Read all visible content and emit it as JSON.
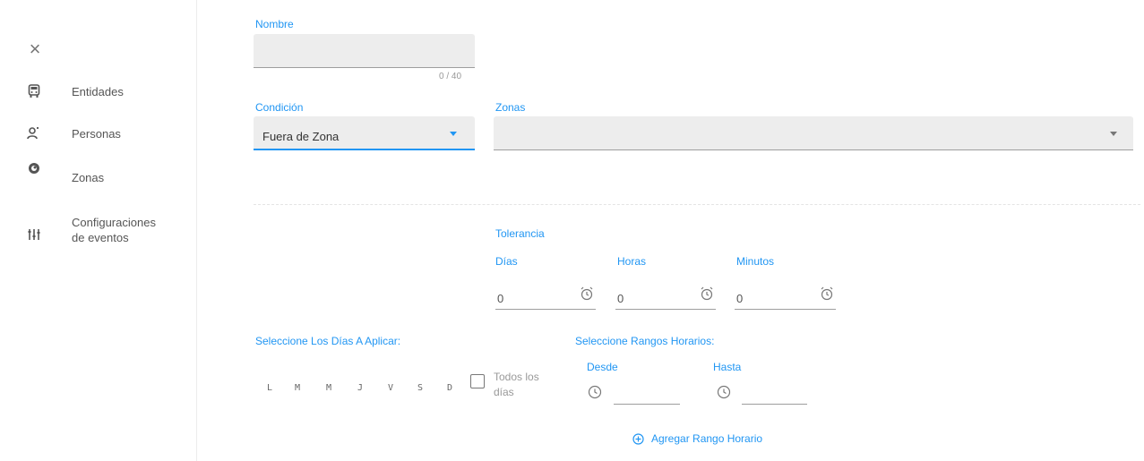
{
  "sidebar": {
    "close_icon": "close-icon",
    "items": [
      {
        "label": "Entidades",
        "icon": "car-icon"
      },
      {
        "label": "Personas",
        "icon": "people-icon"
      },
      {
        "label": "Zonas",
        "icon": "location-icon"
      },
      {
        "label_line1": "Configuraciones",
        "label_line2": "de eventos",
        "icon": "sliders-icon"
      }
    ]
  },
  "form": {
    "nombre": {
      "label": "Nombre",
      "value": "",
      "counter": "0 / 40"
    },
    "condicion": {
      "label": "Condición",
      "value": "Fuera de Zona"
    },
    "zonas": {
      "label": "Zonas",
      "value": ""
    },
    "tolerancia": {
      "title": "Tolerancia",
      "dias": {
        "label": "Días",
        "value": "0"
      },
      "horas": {
        "label": "Horas",
        "value": "0"
      },
      "minutos": {
        "label": "Minutos",
        "value": "0"
      }
    },
    "dias_aplicar": {
      "label": "Seleccione Los Días A Aplicar:",
      "days": [
        "L",
        "M",
        "M",
        "J",
        "V",
        "S",
        "D"
      ],
      "todos_line1": "Todos los",
      "todos_line2": "días"
    },
    "rangos": {
      "label": "Seleccione Rangos Horarios:",
      "desde": {
        "label": "Desde",
        "value": ""
      },
      "hasta": {
        "label": "Hasta",
        "value": ""
      },
      "add_label": "Agregar Rango Horario"
    }
  },
  "colors": {
    "accent": "#2196f3",
    "field_bg": "#ededed"
  }
}
